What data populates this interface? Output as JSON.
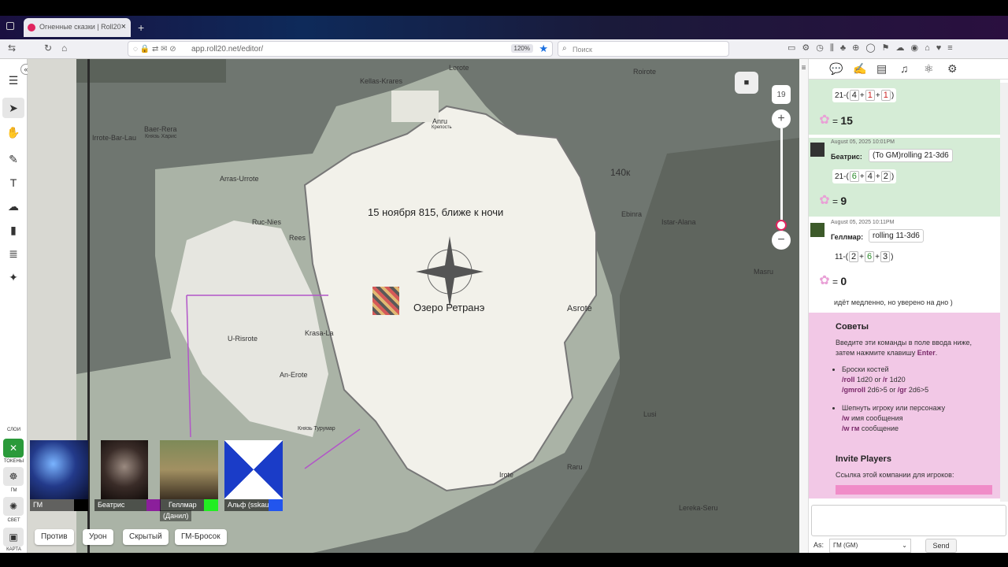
{
  "browser": {
    "tab_title": "Огненные сказки | Roll20",
    "tab_close": "×",
    "new_tab": "+",
    "url": "app.roll20.net/editor/",
    "zoom": "120%",
    "search_placeholder": "Поиск"
  },
  "map": {
    "date_text": "15 ноября 815, ближе к ночи",
    "lake_name": "Озеро Ретранэ",
    "zoom_level": "19",
    "labels": [
      {
        "text": "Kellas-Krares"
      },
      {
        "text": "Lerote"
      },
      {
        "text": "Roirote"
      },
      {
        "text": "Baer-Rera"
      },
      {
        "text": "Князь Харис"
      },
      {
        "text": "Irrote-Bar-Lau"
      },
      {
        "text": "Arras-Urrote"
      },
      {
        "text": "Anru"
      },
      {
        "text": "Крепость"
      },
      {
        "text": "140к"
      },
      {
        "text": "Ruc-Nies"
      },
      {
        "text": "Rees"
      },
      {
        "text": "Ebinra"
      },
      {
        "text": "Istar-Alana"
      },
      {
        "text": "Masru"
      },
      {
        "text": "Asrote"
      },
      {
        "text": "U-Risrote"
      },
      {
        "text": "Krasa-La"
      },
      {
        "text": "An-Erote"
      },
      {
        "text": "Князь Турумар"
      },
      {
        "text": "Lusi"
      },
      {
        "text": "Raru"
      },
      {
        "text": "Irote"
      },
      {
        "text": "Lereka-Seru"
      }
    ]
  },
  "players": [
    {
      "name": "ГМ",
      "sub": "",
      "color": "#000000"
    },
    {
      "name": "Беатрис",
      "sub": "",
      "color": "#8b1f9b"
    },
    {
      "name": "Геллмар",
      "sub": "(Данил)",
      "color": "#22ee22"
    },
    {
      "name": "Альф (sskaut)",
      "sub": "",
      "color": "#2255ee"
    }
  ],
  "macros": [
    "Против",
    "Урон",
    "Скрытый",
    "ГМ-Бросок"
  ],
  "toolbar": {
    "layers_label": "СЛОИ",
    "tokens_label": "ТОКЕНЫ",
    "gm_label": "ГМ",
    "light_label": "СВЕТ",
    "map_label": "КАРТА"
  },
  "chat": {
    "messages": [
      {
        "dice": [
          "4",
          "1",
          "1"
        ],
        "prefix": "21-(",
        "result": "15"
      },
      {
        "timestamp": "August 05, 2025 10:01PM",
        "who": "Беатрис:",
        "text": "(To GM)rolling 21-3d6",
        "prefix": "21-(",
        "dice": [
          "6",
          "4",
          "2"
        ],
        "result": "9"
      },
      {
        "timestamp": "August 05, 2025 10:11PM",
        "who": "Геллмар:",
        "text": "rolling 11-3d6",
        "prefix": "11-(",
        "dice": [
          "2",
          "6",
          "3"
        ],
        "result": "0"
      }
    ],
    "free_text": "идёт медленно, но уверено на дно )",
    "plus": "+",
    "close_paren": ")",
    "equals": "=",
    "help": {
      "title": "Советы",
      "intro": "Введите эти команды в поле ввода ниже, затем нажмите клавишу",
      "enter": "Enter",
      "enter_suffix": ".",
      "bullet1_title": "Броски костей",
      "bullet1_cmd1": "/roll",
      "bullet1_arg1": " 1d20 or ",
      "bullet1_cmd2": "/r",
      "bullet1_arg2": " 1d20",
      "bullet1_cmd3": "/gmroll",
      "bullet1_arg3": " 2d6>5 or ",
      "bullet1_cmd4": "/gr",
      "bullet1_arg4": " 2d6>5",
      "bullet2_title": "Шепнуть игроку или персонажу",
      "bullet2_cmd1": "/w",
      "bullet2_arg1": " имя сообщения",
      "bullet2_cmd2": "/w гм",
      "bullet2_arg2": " сообщение",
      "invite_title": "Invite Players",
      "invite_text": "Ссылка этой компании для игроков:"
    },
    "as_label": "As:",
    "as_value": "ГМ (GM)",
    "send_label": "Send"
  },
  "colors": {
    "chat_roll_bg": "#d5ecd6",
    "help_bg": "#f2c8e6",
    "accent": "#e0245e"
  }
}
